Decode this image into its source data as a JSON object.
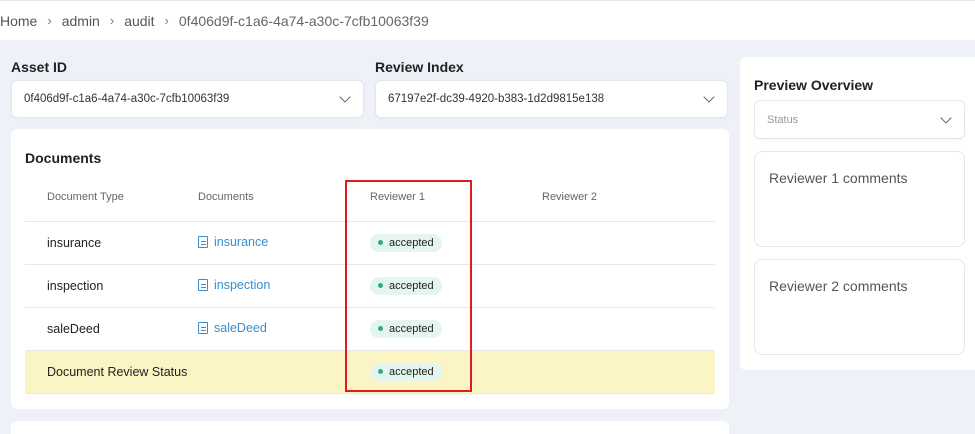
{
  "breadcrumb": {
    "items": [
      "Home",
      "admin",
      "audit",
      "0f406d9f-c1a6-4a74-a30c-7cfb10063f39"
    ]
  },
  "asset": {
    "label": "Asset ID",
    "value": "0f406d9f-c1a6-4a74-a30c-7cfb10063f39"
  },
  "review": {
    "label": "Review Index",
    "value": "67197e2f-dc39-4920-b383-1d2d9815e138"
  },
  "documents": {
    "title": "Documents",
    "columns": [
      "Document Type",
      "Documents",
      "Reviewer 1",
      "Reviewer 2"
    ],
    "rows": [
      {
        "type": "insurance",
        "doc": "insurance",
        "r1": "accepted",
        "r2": ""
      },
      {
        "type": "inspection",
        "doc": "inspection",
        "r1": "accepted",
        "r2": ""
      },
      {
        "type": "saleDeed",
        "doc": "saleDeed",
        "r1": "accepted",
        "r2": ""
      }
    ],
    "status_row": {
      "label": "Document Review Status",
      "r1": "accepted",
      "r2": ""
    }
  },
  "preview": {
    "title": "Preview Overview",
    "status_placeholder": "Status",
    "reviewer1_comments": "Reviewer 1 comments",
    "reviewer2_comments": "Reviewer 2 comments"
  },
  "colors": {
    "accent_link": "#3a8fc9",
    "accepted_dot": "#2fae7a",
    "highlight": "#e01b1b",
    "status_row_bg": "#fbf4c5"
  }
}
